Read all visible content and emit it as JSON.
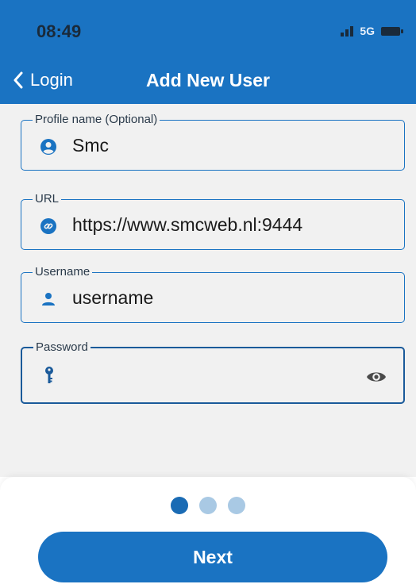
{
  "status_bar": {
    "time": "08:49",
    "network": "5G"
  },
  "nav": {
    "back_label": "Login",
    "title": "Add New User"
  },
  "fields": {
    "profile_name": {
      "label": "Profile name (Optional)",
      "value": "Smc",
      "icon": "person-circle-icon"
    },
    "url": {
      "label": "URL",
      "value": "https://www.smcweb.nl:9444",
      "icon": "link-icon"
    },
    "username": {
      "label": "Username",
      "value": "username",
      "icon": "person-icon"
    },
    "password": {
      "label": "Password",
      "value": "",
      "icon": "key-icon"
    }
  },
  "pagination": {
    "total": 3,
    "current": 1
  },
  "actions": {
    "next_label": "Next"
  },
  "colors": {
    "primary": "#1a73c2",
    "background": "#f1f1f1",
    "dot_inactive": "#a9c9e4"
  }
}
